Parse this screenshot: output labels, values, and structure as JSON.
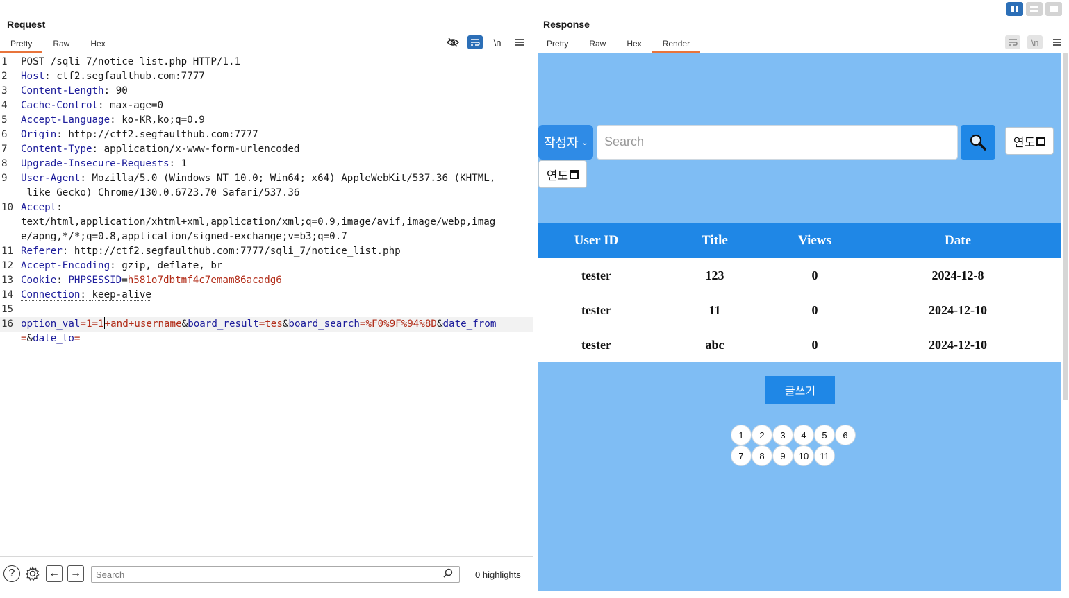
{
  "request": {
    "title": "Request",
    "tabs": [
      "Pretty",
      "Raw",
      "Hex"
    ],
    "tools": {
      "hide_icon": "eye-off-icon",
      "wrap_icon": "wrap-icon",
      "newline_label": "\\n",
      "menu_icon": "hamburger-icon"
    },
    "lines": [
      {
        "n": "1",
        "key": "",
        "sep": "",
        "val": "POST /sqli_7/notice_list.php HTTP/1.1"
      },
      {
        "n": "2",
        "key": "Host",
        "sep": ": ",
        "val": "ctf2.segfaulthub.com:7777"
      },
      {
        "n": "3",
        "key": "Content-Length",
        "sep": ": ",
        "val": "90"
      },
      {
        "n": "4",
        "key": "Cache-Control",
        "sep": ": ",
        "val": "max-age=0"
      },
      {
        "n": "5",
        "key": "Accept-Language",
        "sep": ": ",
        "val": "ko-KR,ko;q=0.9"
      },
      {
        "n": "6",
        "key": "Origin",
        "sep": ": ",
        "val": "http://ctf2.segfaulthub.com:7777"
      },
      {
        "n": "7",
        "key": "Content-Type",
        "sep": ": ",
        "val": "application/x-www-form-urlencoded"
      },
      {
        "n": "8",
        "key": "Upgrade-Insecure-Requests",
        "sep": ": ",
        "val": "1"
      },
      {
        "n": "9",
        "key": "User-Agent",
        "sep": ": ",
        "val": "Mozilla/5.0 (Windows NT 10.0; Win64; x64) AppleWebKit/537.36 (KHTML,"
      },
      {
        "n": "",
        "key": "",
        "sep": "",
        "val": " like Gecko) Chrome/130.0.6723.70 Safari/537.36"
      },
      {
        "n": "10",
        "key": "Accept",
        "sep": ":",
        "val": ""
      },
      {
        "n": "",
        "key": "",
        "sep": "",
        "val": "text/html,application/xhtml+xml,application/xml;q=0.9,image/avif,image/webp,imag"
      },
      {
        "n": "",
        "key": "",
        "sep": "",
        "val": "e/apng,*/*;q=0.8,application/signed-exchange;v=b3;q=0.7"
      },
      {
        "n": "11",
        "key": "Referer",
        "sep": ": ",
        "val": "http://ctf2.segfaulthub.com:7777/sqli_7/notice_list.php"
      },
      {
        "n": "12",
        "key": "Accept-Encoding",
        "sep": ": ",
        "val": "gzip, deflate, br"
      },
      {
        "n": "13",
        "key": "Cookie",
        "sep": ": ",
        "val": "",
        "ck": "PHPSESSID",
        "cv": "h581o7dbtmf4c7emam86acadg6"
      },
      {
        "n": "14",
        "key": "Connection",
        "sep": ": ",
        "val": "keep-alive"
      },
      {
        "n": "15",
        "key": "",
        "sep": "",
        "val": ""
      }
    ],
    "body_line_number": "16",
    "body_params": [
      {
        "k": "option_val",
        "v": "1=1",
        "v2": "+and+username"
      },
      {
        "k": "board_result",
        "v": "tes"
      },
      {
        "k": "board_search",
        "v": "%F0%9F%94%8D"
      },
      {
        "k": "date_from",
        "v": ""
      },
      {
        "k": "date_to",
        "v": ""
      }
    ],
    "footer": {
      "help_icon": "help-icon",
      "settings_icon": "gear-icon",
      "search_placeholder": "Search",
      "highlights": "0 highlights"
    }
  },
  "response": {
    "title": "Response",
    "tabs": [
      "Pretty",
      "Raw",
      "Hex",
      "Render"
    ],
    "active_tab": "Render",
    "render": {
      "select_label": "작성자",
      "search_placeholder": "Search",
      "date_label": "연도",
      "table": {
        "headers": [
          "User ID",
          "Title",
          "Views",
          "Date"
        ],
        "rows": [
          [
            "tester",
            "123",
            "0",
            "2024-12-8"
          ],
          [
            "tester",
            "11",
            "0",
            "2024-12-10"
          ],
          [
            "tester",
            "abc",
            "0",
            "2024-12-10"
          ]
        ]
      },
      "write_button": "글쓰기",
      "pages": [
        "1",
        "2",
        "3",
        "4",
        "5",
        "6",
        "7",
        "8",
        "9",
        "10",
        "11"
      ]
    }
  },
  "colors": {
    "accent": "#2c6fb7",
    "tab_underline": "#e8743b",
    "render_bg": "#7fbdf4",
    "table_header": "#1f87e6"
  }
}
